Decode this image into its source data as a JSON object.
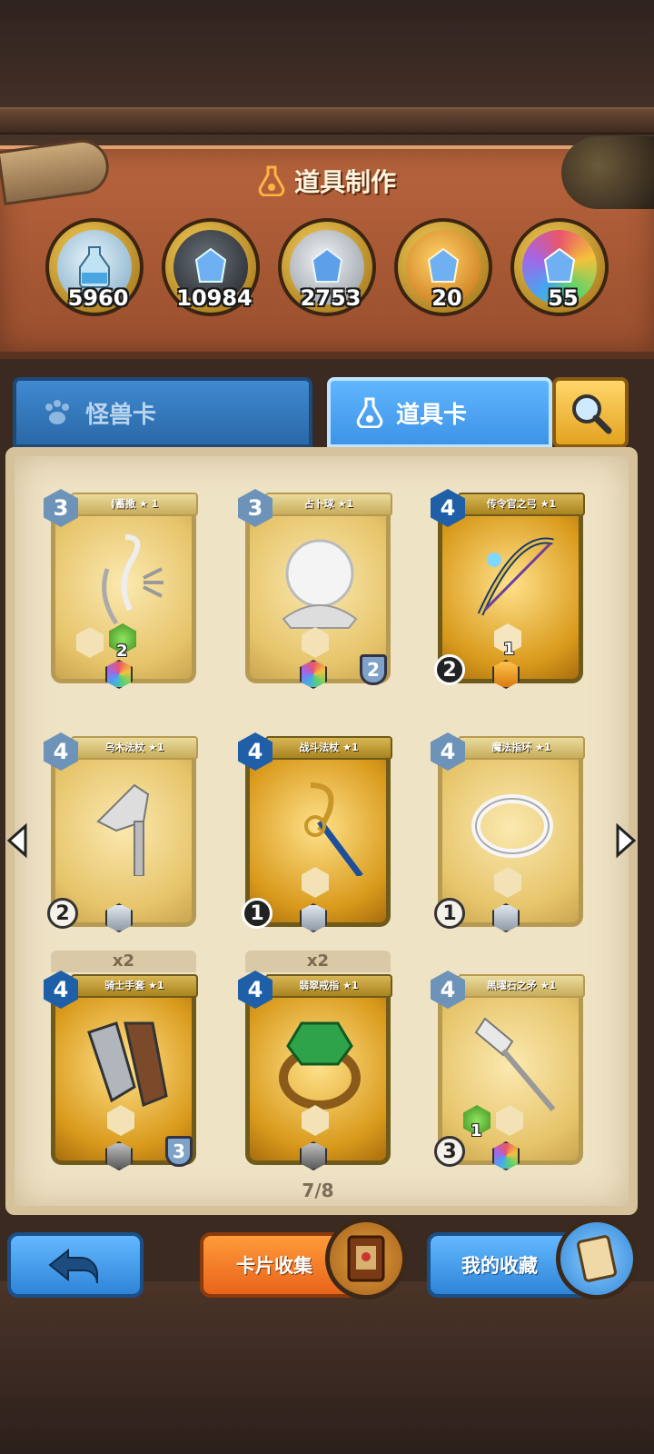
{
  "header": {
    "title": "道具制作",
    "icon": "flask-icon"
  },
  "resources": [
    {
      "name": "bottle-dust",
      "value": "5960",
      "icon": "bottle-icon"
    },
    {
      "name": "dark-crystal",
      "value": "10984",
      "icon": "dark-crystal-icon"
    },
    {
      "name": "silver-crystal",
      "value": "2753",
      "icon": "silver-crystal-icon"
    },
    {
      "name": "gold-crystal",
      "value": "20",
      "icon": "gold-crystal-icon"
    },
    {
      "name": "rainbow-crystal",
      "value": "55",
      "icon": "rainbow-crystal-icon"
    }
  ],
  "tabs": {
    "monster": "怪兽卡",
    "item": "道具卡"
  },
  "cards": [
    {
      "name": "≬蓄撒 ★ 1",
      "cost": "3"
    },
    {
      "name": "占卜球 ★1",
      "cost": "3"
    },
    {
      "name": "传令官之弓 ★1",
      "cost": "4"
    },
    {
      "name": "乌木法杖 ★1",
      "cost": "4"
    },
    {
      "name": "战斗法杖 ★1",
      "cost": "4"
    },
    {
      "name": "魔法指环 ★1",
      "cost": "4"
    },
    {
      "name": "骑士手套 ★1",
      "cost": "4"
    },
    {
      "name": "翡翠戒指 ★1",
      "cost": "4"
    },
    {
      "name": "黑曜石之矛 ★1",
      "cost": "4"
    }
  ],
  "card_stats": {
    "c1_stat": "2",
    "c2_shield": "2",
    "c3_corner": "2",
    "c3_stat": "1",
    "c4_corner": "2",
    "c5_corner": "1",
    "c6_corner": "1",
    "c7_shield": "3",
    "c9_corner": "3",
    "c9_stat": "1"
  },
  "multipliers": {
    "m7": "x2",
    "m8": "x2"
  },
  "pagination": "7/8",
  "buttons": {
    "collect": "卡片收集",
    "my_collection": "我的收藏"
  },
  "colors": {
    "accent_blue": "#3d93e6",
    "accent_orange": "#e8641a",
    "header_brown": "#9a4f2e",
    "parchment": "#efe3c6"
  }
}
